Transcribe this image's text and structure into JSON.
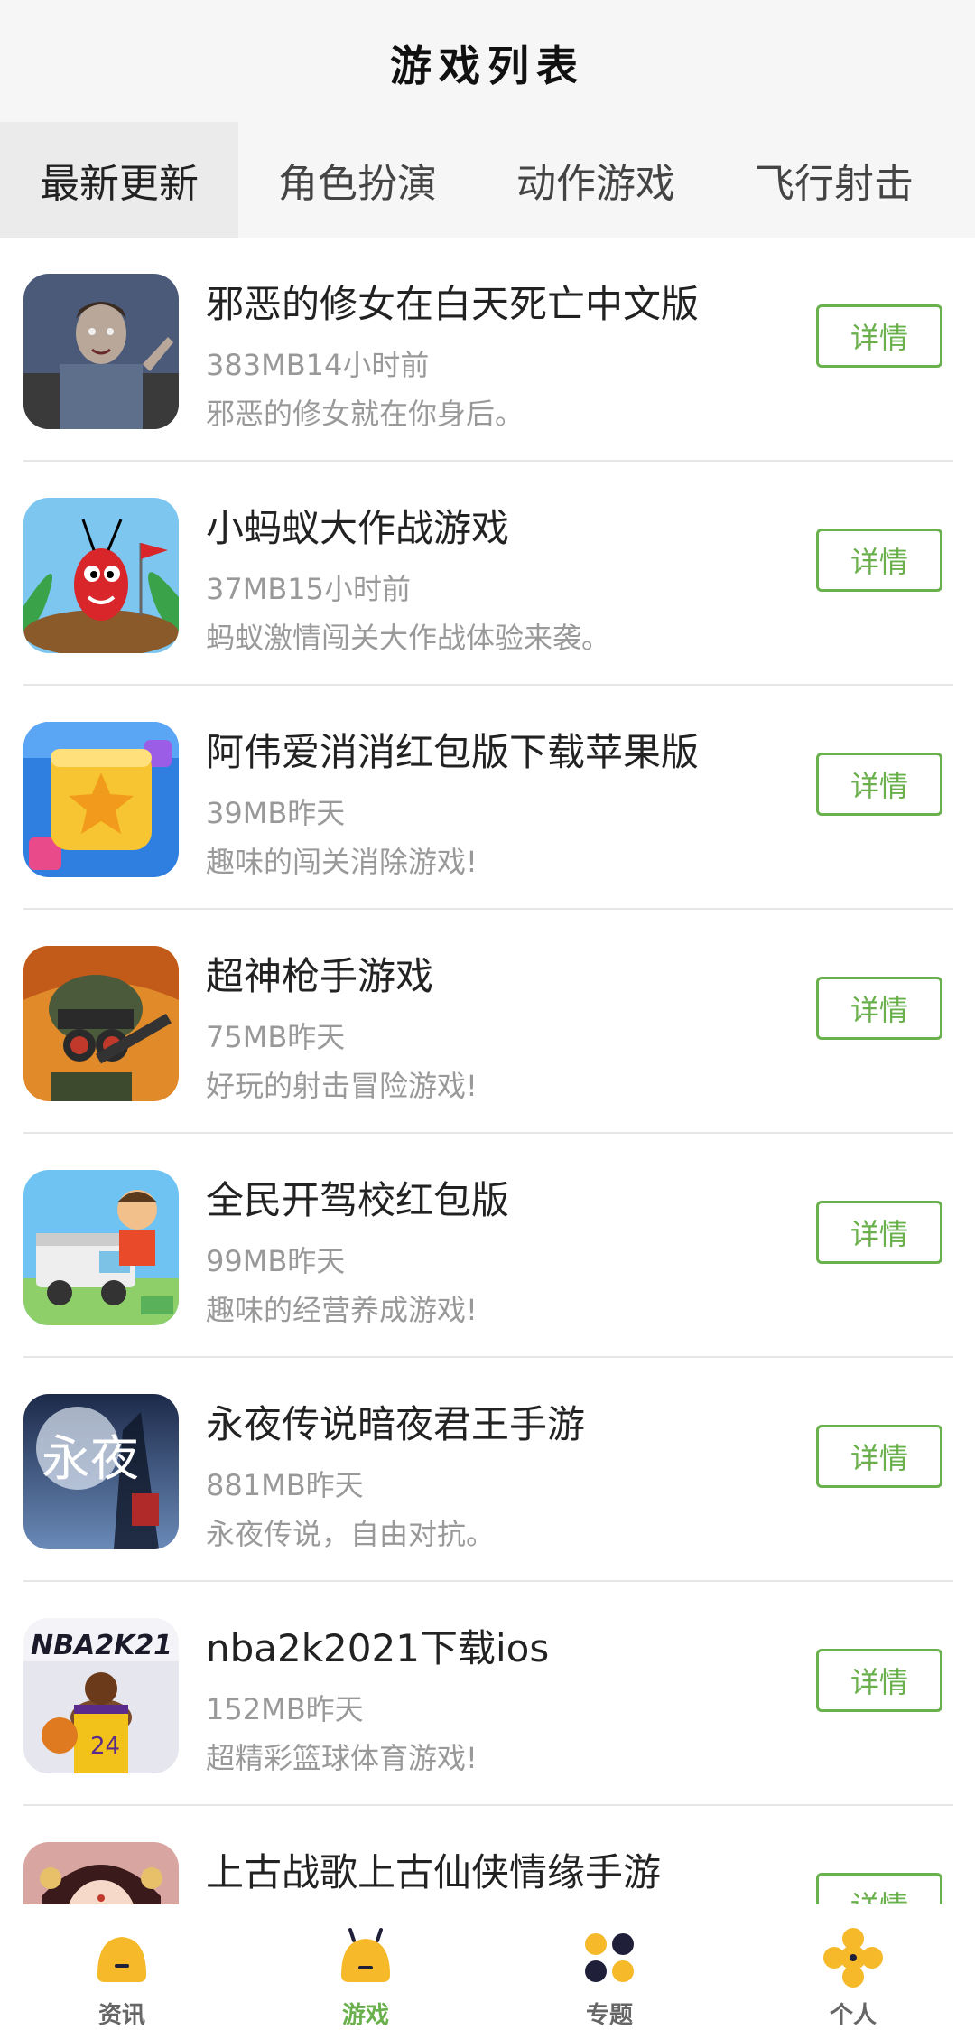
{
  "header": {
    "title": "游戏列表"
  },
  "tabs": [
    {
      "label": "最新更新",
      "active": true
    },
    {
      "label": "角色扮演",
      "active": false
    },
    {
      "label": "动作游戏",
      "active": false
    },
    {
      "label": "飞行射击",
      "active": false
    }
  ],
  "games": [
    {
      "name": "邪恶的修女在白天死亡中文版",
      "meta": "383MB14小时前",
      "desc": "邪恶的修女就在你身后。",
      "button": "详情",
      "icon": "zombie-game-icon"
    },
    {
      "name": "小蚂蚁大作战游戏",
      "meta": "37MB15小时前",
      "desc": "蚂蚁激情闯关大作战体验来袭。",
      "button": "详情",
      "icon": "ant-game-icon"
    },
    {
      "name": "阿伟爱消消红包版下载苹果版",
      "meta": "39MB昨天",
      "desc": "趣味的闯关消除游戏!",
      "button": "详情",
      "icon": "star-block-game-icon"
    },
    {
      "name": "超神枪手游戏",
      "meta": "75MB昨天",
      "desc": "好玩的射击冒险游戏!",
      "button": "详情",
      "icon": "gunner-game-icon"
    },
    {
      "name": "全民开驾校红包版",
      "meta": "99MB昨天",
      "desc": "趣味的经营养成游戏!",
      "button": "详情",
      "icon": "driving-school-game-icon"
    },
    {
      "name": "永夜传说暗夜君王手游",
      "meta": "881MB昨天",
      "desc": "永夜传说，自由对抗。",
      "button": "详情",
      "icon": "night-legend-game-icon",
      "icon_text": "永夜"
    },
    {
      "name": "nba2k2021下载ios",
      "meta": "152MB昨天",
      "desc": "超精彩篮球体育游戏!",
      "button": "详情",
      "icon": "nba2k21-game-icon",
      "icon_text": "NBA2K21"
    },
    {
      "name": "上古战歌上古仙侠情缘手游",
      "meta": "",
      "desc": "",
      "button": "详情",
      "icon": "xianxia-game-icon"
    }
  ],
  "bottom_nav": [
    {
      "label": "资讯",
      "active": false,
      "icon": "news-icon"
    },
    {
      "label": "游戏",
      "active": true,
      "icon": "game-icon"
    },
    {
      "label": "专题",
      "active": false,
      "icon": "topic-icon"
    },
    {
      "label": "个人",
      "active": false,
      "icon": "profile-icon"
    }
  ],
  "colors": {
    "accent": "#6ab04c",
    "nav_yellow": "#f5b92a",
    "nav_dark": "#1f1f3a"
  }
}
